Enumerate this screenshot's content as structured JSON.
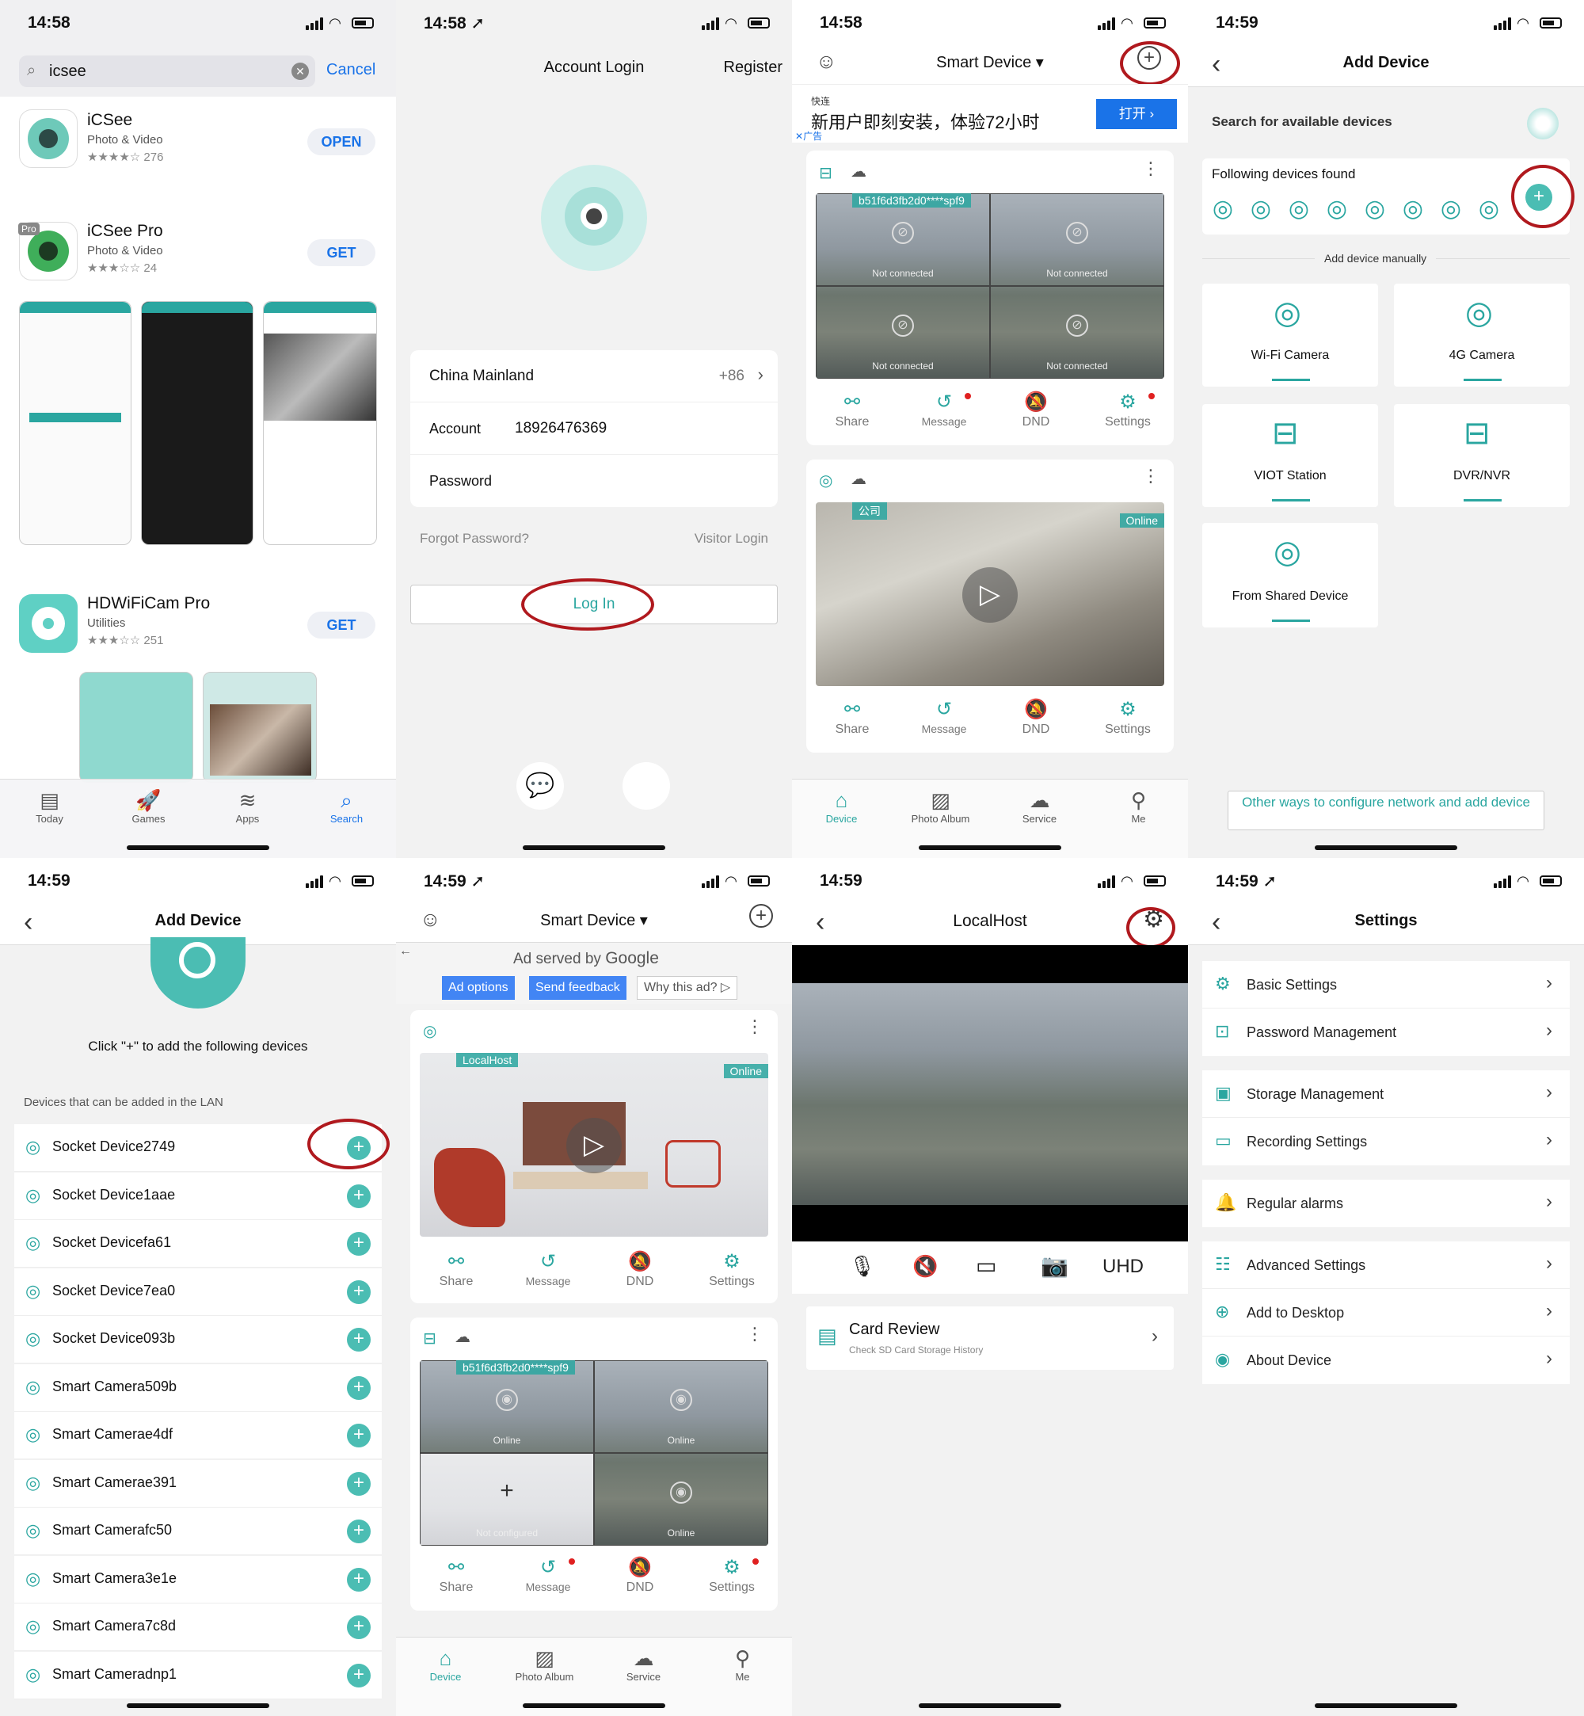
{
  "colors": {
    "accent": "#2aa6a0",
    "annotation_circle": "#b0191e",
    "ios_blue": "#1a73e8"
  },
  "p1": {
    "time": "14:58",
    "search_value": "icsee",
    "cancel": "Cancel",
    "apps": [
      {
        "name": "iCSee",
        "category": "Photo & Video",
        "rating_count": "276",
        "button": "OPEN",
        "rating": 4
      },
      {
        "name": "iCSee Pro",
        "category": "Photo & Video",
        "rating_count": "24",
        "button": "GET",
        "rating": 3.5,
        "badge": "Pro"
      },
      {
        "name": "HDWiFiCam Pro",
        "category": "Utilities",
        "rating_count": "251",
        "button": "GET",
        "rating": 3.5
      }
    ],
    "tabs": [
      "Today",
      "Games",
      "Apps",
      "Search"
    ],
    "active_tab": "Search"
  },
  "p2": {
    "time": "14:58",
    "title": "Account Login",
    "register": "Register",
    "region": "China Mainland",
    "region_code": "+86",
    "account_label": "Account",
    "account_value": "18926476369",
    "password_label": "Password",
    "forgot": "Forgot Password?",
    "visitor": "Visitor Login",
    "login": "Log In"
  },
  "p3": {
    "time": "14:58",
    "title": "Smart Device",
    "ad_source": "快连",
    "ad_text": "新用户即刻安装，体验72小时",
    "ad_button": "打开",
    "ad_label": "广告",
    "dev1": {
      "id": "b51f6d3fb2d0****spf9",
      "cells": [
        "Not connected",
        "Not connected",
        "Not connected",
        "Not connected"
      ]
    },
    "dev2": {
      "tag": "公司",
      "status": "Online"
    },
    "actions": [
      "Share",
      "Message",
      "DND",
      "Settings"
    ],
    "tabs": [
      "Device",
      "Photo Album",
      "Service",
      "Me"
    ],
    "active_tab": "Device"
  },
  "p4": {
    "time": "14:59",
    "title": "Add Device",
    "search_label": "Search for available devices",
    "found_label": "Following devices found",
    "found_count": 8,
    "manual_label": "Add device manually",
    "types": [
      "Wi-Fi Camera",
      "4G Camera",
      "VIOT Station",
      "DVR/NVR",
      "From Shared Device"
    ],
    "other_ways": "Other ways to configure network and add device"
  },
  "p5": {
    "time": "14:59",
    "title": "Add Device",
    "hint": "Click \"+\" to add the following devices",
    "lan_label": "Devices that can be added in the LAN",
    "devices": [
      "Socket Device2749",
      "Socket Device1aae",
      "Socket Devicefa61",
      "Socket Device7ea0",
      "Socket Device093b",
      "Smart Camera509b",
      "Smart Camerae4df",
      "Smart Camerae391",
      "Smart Camerafc50",
      "Smart Camera3e1e",
      "Smart Camera7c8d",
      "Smart Cameradnp1"
    ]
  },
  "p6": {
    "time": "14:59",
    "title": "Smart Device",
    "ad_served": "Ad served by",
    "google": "Google",
    "ad_options": "Ad options",
    "send_feedback": "Send feedback",
    "why_ad": "Why this ad?",
    "dev1": {
      "tag": "LocalHost",
      "status": "Online"
    },
    "dev2": {
      "id": "b51f6d3fb2d0****spf9",
      "cells": [
        "Online",
        "Online",
        "Not configured",
        "Online"
      ]
    },
    "actions": [
      "Share",
      "Message",
      "DND",
      "Settings"
    ],
    "tabs": [
      "Device",
      "Photo Album",
      "Service",
      "Me"
    ],
    "active_tab": "Device"
  },
  "p7": {
    "time": "14:59",
    "title": "LocalHost",
    "quality": "UHD",
    "card_title": "Card Review",
    "card_sub": "Check SD Card Storage History"
  },
  "p8": {
    "time": "14:59",
    "title": "Settings",
    "items": [
      "Basic Settings",
      "Password Management",
      "Storage Management",
      "Recording Settings",
      "Regular alarms",
      "Advanced Settings",
      "Add to Desktop",
      "About Device"
    ]
  }
}
